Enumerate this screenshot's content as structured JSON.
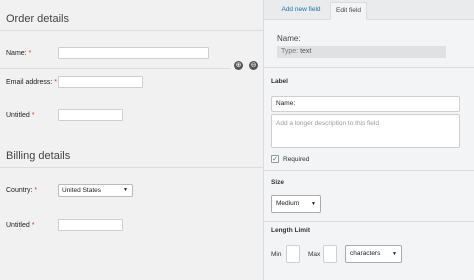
{
  "order_section": {
    "title": "Order details",
    "fields": [
      {
        "label": "Name:",
        "required": "*"
      },
      {
        "label": "Email address:",
        "required": "*"
      },
      {
        "label": "Untitled",
        "required": "*"
      }
    ]
  },
  "billing_section": {
    "title": "Billing details",
    "country_label": "Country:",
    "country_required": "*",
    "country_value": "United States",
    "untitled_label": "Untitled",
    "untitled_required": "*"
  },
  "row_actions": {
    "add_icon": "plus-circle-icon",
    "remove_icon": "minus-circle-icon",
    "add_glyph": "⊕",
    "remove_glyph": "⊖"
  },
  "panel": {
    "tabs": [
      "Add new field",
      "Edit field"
    ],
    "active_tab": "Edit field",
    "name_heading": "Name:",
    "type_label": "Type:",
    "type_value": "text",
    "label_section": {
      "title": "Label",
      "value": "Name:",
      "description_placeholder": "Add a longer description to this field",
      "required_label": "Required",
      "required_checked": true,
      "check_mark": "✓"
    },
    "size_section": {
      "title": "Size",
      "value": "Medium"
    },
    "length_section": {
      "title": "Length Limit",
      "min_label": "Min",
      "max_label": "Max",
      "unit_value": "characters"
    }
  }
}
